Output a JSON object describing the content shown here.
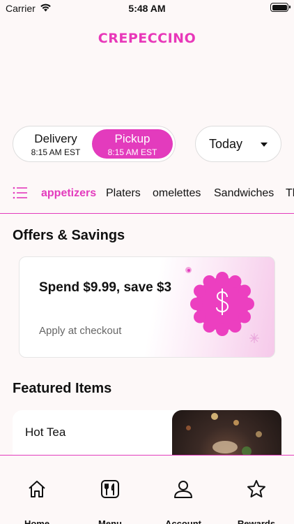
{
  "status_bar": {
    "carrier": "Carrier",
    "time": "5:48 AM"
  },
  "brand": {
    "logo_text": "CREPECCINO",
    "accent_color": "#e33bbd"
  },
  "order_mode": {
    "delivery": {
      "label": "Delivery",
      "time": "8:15 AM EST"
    },
    "pickup": {
      "label": "Pickup",
      "time": "8:15 AM EST",
      "selected": true
    }
  },
  "day_selector": {
    "value": "Today"
  },
  "categories": {
    "icon": "menu-list-icon",
    "items": [
      {
        "label": "appetizers",
        "active": true
      },
      {
        "label": "Platers"
      },
      {
        "label": "omelettes"
      },
      {
        "label": "Sandwiches"
      },
      {
        "label": "Th"
      }
    ]
  },
  "offers": {
    "title": "Offers & Savings",
    "card": {
      "headline": "Spend $9.99, save $3",
      "subtitle": "Apply at checkout",
      "icon": "dollar-badge-icon"
    }
  },
  "featured": {
    "title": "Featured Items",
    "items": [
      {
        "name": "Hot Tea"
      }
    ]
  },
  "tab_bar": {
    "items": [
      {
        "label": "Home",
        "icon": "home-icon"
      },
      {
        "label": "Menu",
        "icon": "menu-icon"
      },
      {
        "label": "Account",
        "icon": "account-icon"
      },
      {
        "label": "Rewards",
        "icon": "star-icon"
      }
    ]
  }
}
